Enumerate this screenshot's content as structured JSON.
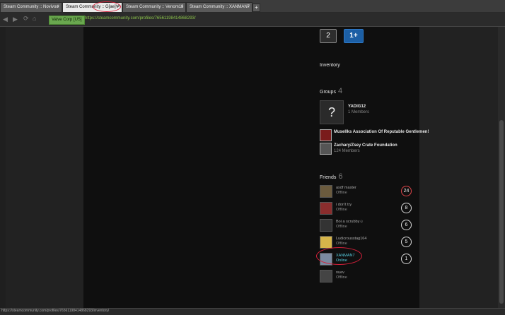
{
  "tabs": [
    {
      "label": "Steam Community :: Novivod"
    },
    {
      "label": "Steam Community :: G[ae]V^"
    },
    {
      "label": "Steam Community :: Venom13"
    },
    {
      "label": "Steam Community :: XANMAN7"
    }
  ],
  "new_tab_label": "+",
  "close_glyph": "×",
  "nav": {
    "back_icon": "◀",
    "forward_icon": "▶",
    "reload_icon": "⟳",
    "home_icon": "⌂",
    "site_badge": "Valve Corp [US]",
    "url": "https://steamcommunity.com/profiles/76561198414868293/"
  },
  "badges": {
    "first": "2",
    "second": "1+"
  },
  "inventory_label": "Inventory",
  "groups": {
    "title": "Groups",
    "count": "4",
    "items": [
      {
        "name": "YADIG12",
        "meta": "1 Members",
        "icon": "?"
      },
      {
        "name": "Musellks Association Of Reputable Gentlemen!",
        "meta": ""
      },
      {
        "name": "Zachary/Zsey Crate Foundation",
        "meta": "124 Members"
      }
    ]
  },
  "friends": {
    "title": "Friends",
    "count": "6",
    "items": [
      {
        "name": "asdf master",
        "status": "Offline",
        "level": "24",
        "avatar_color": "#6b5b3e"
      },
      {
        "name": "i don't try",
        "status": "Offline",
        "level": "8",
        "avatar_color": "#8a2d2d"
      },
      {
        "name": "Boi a scrubby☺",
        "status": "Offline",
        "level": "6",
        "avatar_color": "#333333"
      },
      {
        "name": "Ludicrousstag164",
        "status": "Offline",
        "level": "5",
        "avatar_color": "#d6b54a"
      },
      {
        "name": "XANMAN7",
        "status": "Online",
        "level": "1",
        "avatar_color": "#7a8aa0"
      },
      {
        "name": "nuev",
        "status": "Offline",
        "level": "",
        "avatar_color": "#444444"
      }
    ]
  },
  "status_url": "https://steamcommunity.com/profiles/76561198414868293/inventory/",
  "colors": {
    "accent_online": "#57cbde",
    "level_red": "#e1454a",
    "annotation_red": "#d5203a"
  }
}
